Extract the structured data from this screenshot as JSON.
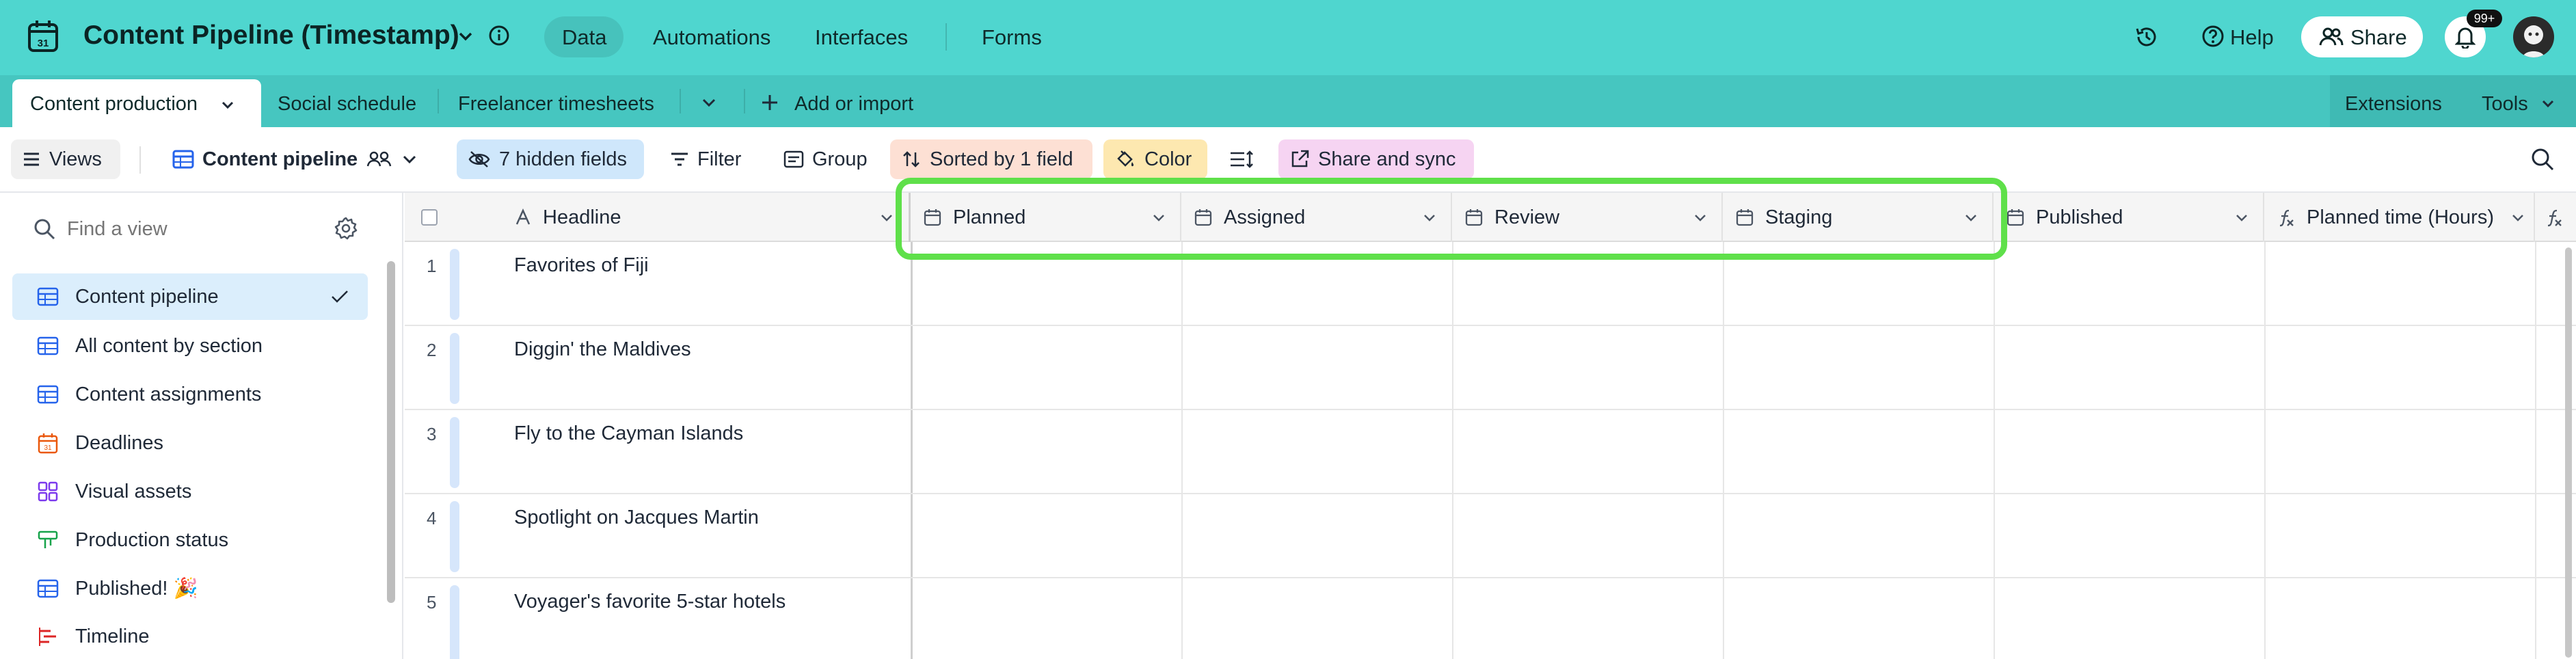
{
  "app": {
    "title": "Content Pipeline (Timestamp)",
    "nav": [
      "Data",
      "Automations",
      "Interfaces",
      "Forms"
    ],
    "help": "Help",
    "share": "Share",
    "notif_badge": "99+"
  },
  "tabs": {
    "items": [
      "Content production",
      "Social schedule",
      "Freelancer timesheets"
    ],
    "add": "Add or import",
    "extensions": "Extensions",
    "tools": "Tools"
  },
  "toolbar": {
    "views": "Views",
    "view_name": "Content pipeline",
    "hidden": "7 hidden fields",
    "filter": "Filter",
    "group": "Group",
    "sort": "Sorted by 1 field",
    "color": "Color",
    "share_sync": "Share and sync"
  },
  "sidebar": {
    "find_placeholder": "Find a view",
    "items": [
      {
        "label": "Content pipeline",
        "icon": "grid-icon"
      },
      {
        "label": "All content by section",
        "icon": "grid-icon"
      },
      {
        "label": "Content assignments",
        "icon": "grid-icon"
      },
      {
        "label": "Deadlines",
        "icon": "calendar-icon"
      },
      {
        "label": "Visual assets",
        "icon": "gallery-icon"
      },
      {
        "label": "Production status",
        "icon": "kanban-icon"
      },
      {
        "label": "Published! 🎉",
        "icon": "grid-icon"
      },
      {
        "label": "Timeline",
        "icon": "timeline-icon"
      }
    ]
  },
  "grid": {
    "columns": [
      "Headline",
      "Planned",
      "Assigned",
      "Review",
      "Staging",
      "Published",
      "Planned time (Hours)"
    ],
    "rows": [
      {
        "num": "1",
        "headline": "Favorites of Fiji"
      },
      {
        "num": "2",
        "headline": "Diggin' the Maldives"
      },
      {
        "num": "3",
        "headline": "Fly to the Cayman Islands"
      },
      {
        "num": "4",
        "headline": "Spotlight on Jacques Martin"
      },
      {
        "num": "5",
        "headline": "Voyager's favorite 5-star hotels"
      }
    ]
  },
  "colors": {
    "header": "#4fd6cf",
    "tabbar": "#46c6c0",
    "highlight": "#5fe04a",
    "active_view": "#dbeefc"
  }
}
